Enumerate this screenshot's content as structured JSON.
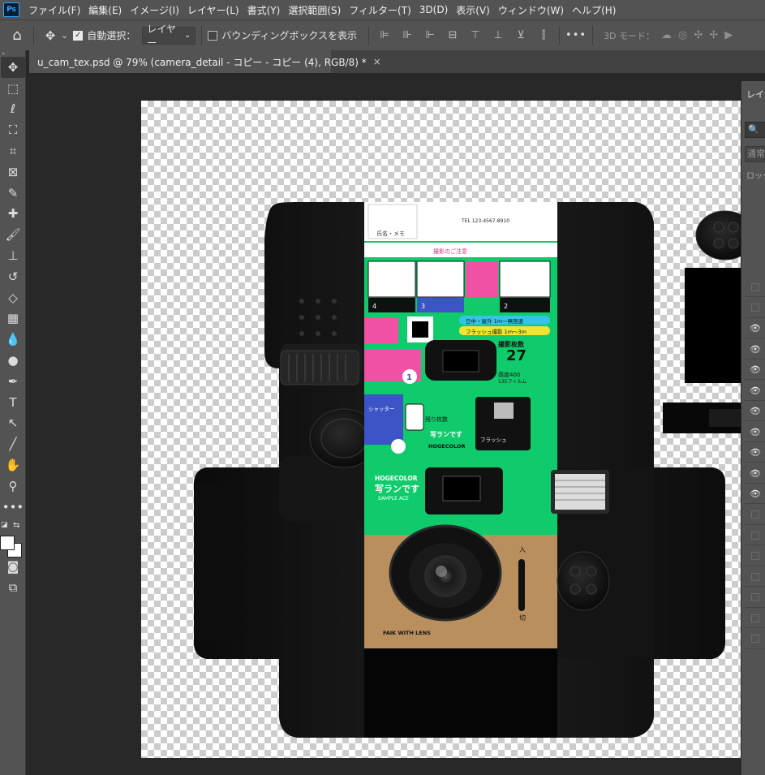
{
  "app": {
    "logo": "Ps"
  },
  "menu": [
    "ファイル(F)",
    "編集(E)",
    "イメージ(I)",
    "レイヤー(L)",
    "書式(Y)",
    "選択範囲(S)",
    "フィルター(T)",
    "3D(D)",
    "表示(V)",
    "ウィンドウ(W)",
    "ヘルプ(H)"
  ],
  "options": {
    "home_icon": "⌂",
    "move_icon": "✥",
    "dropdown_arrow": "⌄",
    "auto_select_label": "自動選択：",
    "auto_select_checked": "✓",
    "layer_target": "レイヤー",
    "bounding_box_label": "バウンディングボックスを表示",
    "align_icons": [
      "⊫",
      "⊪",
      "⊩",
      "⊟",
      "⊤",
      "⊥",
      "⊻",
      "⫿"
    ],
    "more": "•••",
    "mode3d_label": "3D モード：",
    "mode3d_icons": [
      "☁",
      "◎",
      "✣",
      "✢",
      "▶"
    ]
  },
  "tab": {
    "title": "u_cam_tex.psd @ 79% (camera_detail - コピー - コピー (4), RGB/8) *",
    "close": "×"
  },
  "toolbar": {
    "grip": "»",
    "tools": [
      {
        "name": "move-tool",
        "glyph": "✥"
      },
      {
        "name": "marquee-tool",
        "glyph": "⬚"
      },
      {
        "name": "lasso-tool",
        "glyph": "ℓ"
      },
      {
        "name": "object-select-tool",
        "glyph": "⛶"
      },
      {
        "name": "crop-tool",
        "glyph": "⌗"
      },
      {
        "name": "frame-tool",
        "glyph": "⊠"
      },
      {
        "name": "eyedropper-tool",
        "glyph": "✎"
      },
      {
        "name": "healing-tool",
        "glyph": "✚"
      },
      {
        "name": "brush-tool",
        "glyph": "🖌"
      },
      {
        "name": "stamp-tool",
        "glyph": "⊥"
      },
      {
        "name": "history-brush-tool",
        "glyph": "↺"
      },
      {
        "name": "eraser-tool",
        "glyph": "◇"
      },
      {
        "name": "gradient-tool",
        "glyph": "▦"
      },
      {
        "name": "blur-tool",
        "glyph": "💧"
      },
      {
        "name": "dodge-tool",
        "glyph": "●"
      },
      {
        "name": "pen-tool",
        "glyph": "✒"
      },
      {
        "name": "type-tool",
        "glyph": "T"
      },
      {
        "name": "path-select-tool",
        "glyph": "↖"
      },
      {
        "name": "line-tool",
        "glyph": "╱"
      },
      {
        "name": "hand-tool",
        "glyph": "✋"
      },
      {
        "name": "zoom-tool",
        "glyph": "⚲"
      },
      {
        "name": "more-tools",
        "glyph": "•••"
      }
    ],
    "swap_glyph": "⇆",
    "mini_glyph": "◪",
    "quickmask_glyph": "◙",
    "screenmode_glyph": "⧉",
    "fg_color": "#ffffff",
    "bg_color": "#ffffff"
  },
  "panel": {
    "tab_label": "レイヤー",
    "search_icon": "🔍",
    "blend_mode": "通常",
    "lock_label": "ロック：",
    "layer_visibility": [
      false,
      false,
      true,
      true,
      true,
      true,
      true,
      true,
      true,
      true,
      true,
      false,
      false,
      false,
      false,
      false,
      false,
      false
    ],
    "eye_glyph": "👁"
  },
  "artwork": {
    "brand": "HOGECOLOR",
    "product": "写ランです",
    "sample": "SAMPLE ACE",
    "lens_text": "FAIK WITH LENS",
    "count": "27",
    "count_label": "撮影枚数",
    "iso_label": "135フィルム",
    "iso_value": "感度400",
    "step_labels": [
      "1",
      "2",
      "3",
      "4"
    ],
    "flash_label": "フラッシュ",
    "on_label": "入",
    "off_label": "切",
    "remaining_label": "残り枚数",
    "shutter_label": "シャッター",
    "instructions_top": "撮影のご注意",
    "phone": "TEL 123-4567-8910",
    "memo": "氏名・メモ",
    "range1": "フラッシュ撮影 1m〜3m",
    "range2": "日中・屋外 1m〜無限遠",
    "colors": {
      "green": "#0fcb6c",
      "tan": "#b98f5d",
      "pink": "#f051a5",
      "blue": "#3c54c5",
      "black": "#101010"
    }
  }
}
